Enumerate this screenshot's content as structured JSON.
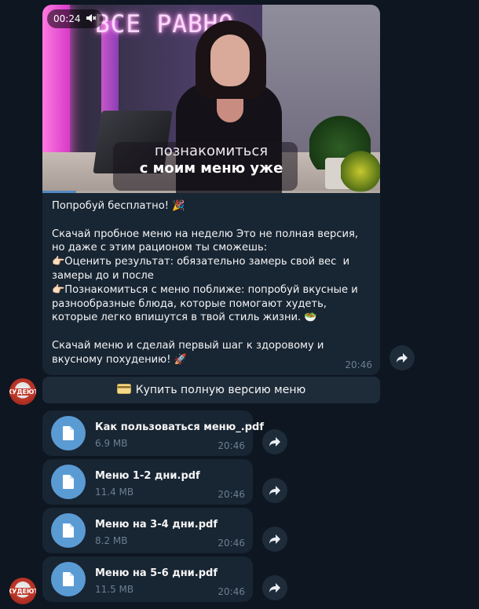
{
  "video": {
    "duration": "00:24",
    "progress_fraction": 0.1,
    "neon_text": "ВСЕ РАВНО",
    "caption_line1": "познакомиться",
    "caption_line2": "с моим меню уже"
  },
  "message": {
    "text": "Попробуй бесплатно! 🎉\n\nСкачай пробное меню на неделю Это не полная версия, но даже с этим рационом ты сможешь:\n👉🏻Оценить результат: обязательно замерь свой вес  и замеры до и после\n👉🏻Познакомиться с меню поближе: попробуй вкусные и разнообразные блюда, которые помогают худеть, которые легко впишутся в твой стиль жизни. 🥗\n\nСкачай меню и сделай первый шаг к здоровому и вкусному похудению! 🚀",
    "time": "20:46"
  },
  "inline_button": {
    "icon": "credit-card-icon",
    "label": "Купить полную версию меню"
  },
  "avatar_text": "ХУДЕЮТ",
  "documents": [
    {
      "name": "Как пользоваться меню_.pdf",
      "size": "6.9 MB",
      "time": "20:46"
    },
    {
      "name": "Меню 1-2 дни.pdf",
      "size": "11.4 MB",
      "time": "20:46"
    },
    {
      "name": "Меню на 3-4 дни.pdf",
      "size": "8.2 MB",
      "time": "20:46"
    },
    {
      "name": "Меню на 5-6 дни.pdf",
      "size": "11.5 MB",
      "time": "20:46"
    }
  ],
  "colors": {
    "background": "#0e1621",
    "bubble": "#182533",
    "accent": "#5a9bd4",
    "muted": "#6d7f8f"
  }
}
